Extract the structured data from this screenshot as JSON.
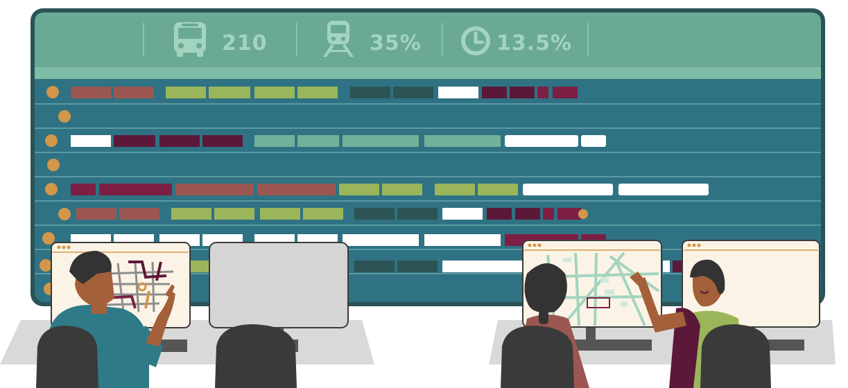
{
  "stats": [
    {
      "icon": "bus-icon",
      "value": "210"
    },
    {
      "icon": "train-icon",
      "value": "35%"
    },
    {
      "icon": "clock-icon",
      "value": "13.5%"
    }
  ],
  "colors": {
    "frame": "#2b5357",
    "header": "#6aa995",
    "board": "#2f7283",
    "row_line": "#5b9aa3",
    "dot": "#d3964a",
    "red": "#9b5651",
    "green": "#9bb65a",
    "dark": "#2c5456",
    "white": "#ffffff",
    "maroon": "#5c1839",
    "magenta": "#7d1f45",
    "teal": "#72b199"
  },
  "rows": [
    {
      "segments": [
        [
          "red",
          2
        ],
        [
          "gap",
          0.5
        ],
        [
          "green",
          4
        ],
        [
          "gap",
          0.5
        ],
        [
          "dark",
          2
        ],
        [
          "white",
          1
        ],
        [
          "maroon",
          2
        ],
        [
          "magenta",
          1.5
        ]
      ]
    },
    {
      "segments": []
    },
    {
      "segments": [
        [
          "white",
          1
        ],
        [
          "maroon",
          3
        ],
        [
          "gap",
          0.5
        ],
        [
          "teal",
          5
        ],
        [
          "white",
          2.5
        ]
      ]
    },
    {
      "segments": []
    },
    {
      "segments": [
        [
          "maroon",
          0.6
        ],
        [
          "red",
          4
        ],
        [
          "green",
          2
        ],
        [
          "gap",
          0.3
        ],
        [
          "green",
          2
        ],
        [
          "white",
          2
        ],
        [
          "white",
          2
        ]
      ]
    },
    {
      "segments": [
        [
          "red",
          2
        ],
        [
          "gap",
          0.3
        ],
        [
          "green",
          4
        ],
        [
          "gap",
          0.3
        ],
        [
          "dark",
          2
        ],
        [
          "white",
          1
        ],
        [
          "maroon",
          2
        ],
        [
          "magenta",
          1
        ]
      ]
    },
    {
      "segments": [
        [
          "white",
          3
        ],
        [
          "white",
          2
        ],
        [
          "white",
          2
        ],
        [
          "maroon",
          2
        ]
      ]
    },
    {
      "segments": [
        [
          "red",
          0.5
        ],
        [
          "green",
          2
        ],
        [
          "dark",
          2
        ],
        [
          "white",
          4
        ],
        [
          "maroon",
          0.5
        ]
      ]
    }
  ]
}
